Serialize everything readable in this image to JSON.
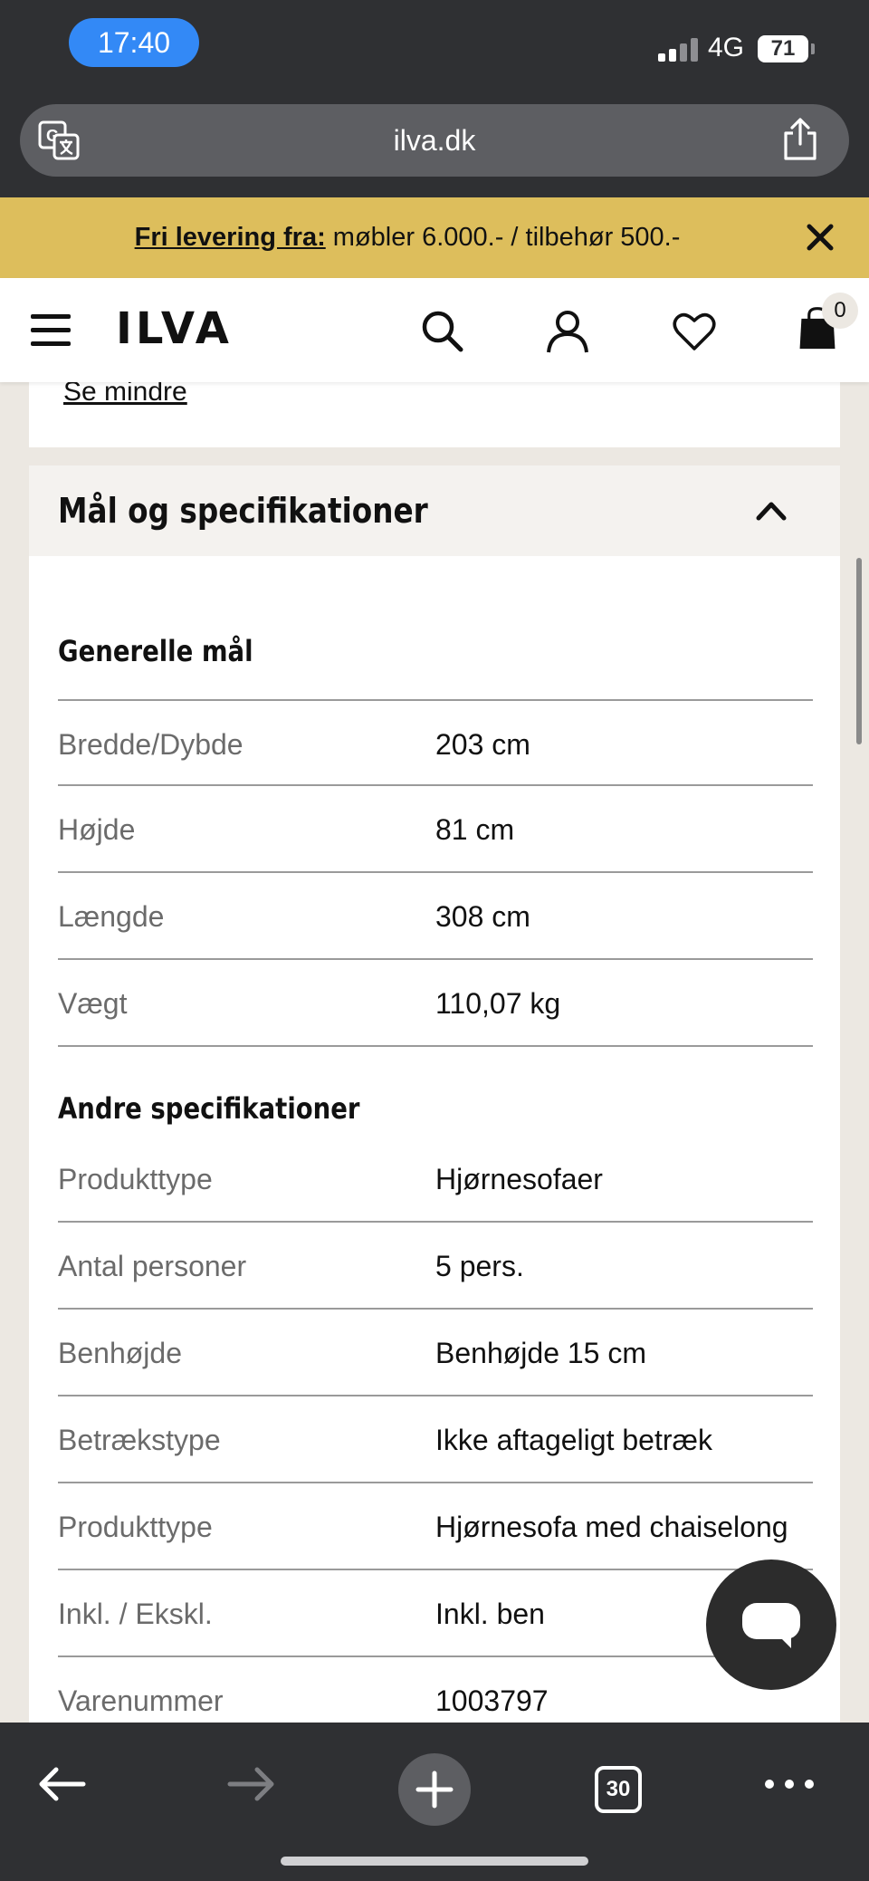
{
  "status_bar": {
    "time": "17:40",
    "network": "4G",
    "battery": "71"
  },
  "browser": {
    "url": "ilva.dk",
    "tabs_count": "30",
    "icons": {
      "translate": "translate-icon",
      "share": "share-icon",
      "back": "back-arrow-icon",
      "forward": "forward-arrow-icon",
      "new_tab": "plus-icon",
      "more": "more-dots-icon"
    }
  },
  "promo": {
    "bold_text": "Fri levering fra:",
    "text": " møbler 6.000.- / tilbehør 500.-"
  },
  "header": {
    "logo": "ILVA",
    "cart_count": "0",
    "icons": [
      "menu-icon",
      "search-icon",
      "account-icon",
      "wishlist-heart-icon",
      "cart-bag-icon"
    ]
  },
  "previous_section": {
    "link": "Se mindre"
  },
  "specs": {
    "title": "Mål og specifikationer",
    "general": {
      "title": "Generelle mål",
      "rows": [
        {
          "label": "Bredde/Dybde",
          "value": "203 cm"
        },
        {
          "label": "Højde",
          "value": "81 cm"
        },
        {
          "label": "Længde",
          "value": "308 cm"
        },
        {
          "label": "Vægt",
          "value": "110,07 kg"
        }
      ]
    },
    "other": {
      "title": "Andre specifikationer",
      "rows": [
        {
          "label": "Produkttype",
          "value": "Hjørnesofaer"
        },
        {
          "label": "Antal personer",
          "value": "5 pers."
        },
        {
          "label": "Benhøjde",
          "value": "Benhøjde 15 cm"
        },
        {
          "label": "Betrækstype",
          "value": "Ikke aftageligt betræk"
        },
        {
          "label": "Produkttype",
          "value": "Hjørnesofa med chaiselong"
        },
        {
          "label": "Inkl. / Ekskl.",
          "value": "Inkl. ben"
        },
        {
          "label": "Varenummer",
          "value": "1003797"
        }
      ]
    }
  },
  "colors": {
    "browser_chrome": "#2f3033",
    "promo_bg": "#ddbe5c",
    "page_bg": "#ece8e2",
    "time_pill": "#3389f6"
  }
}
